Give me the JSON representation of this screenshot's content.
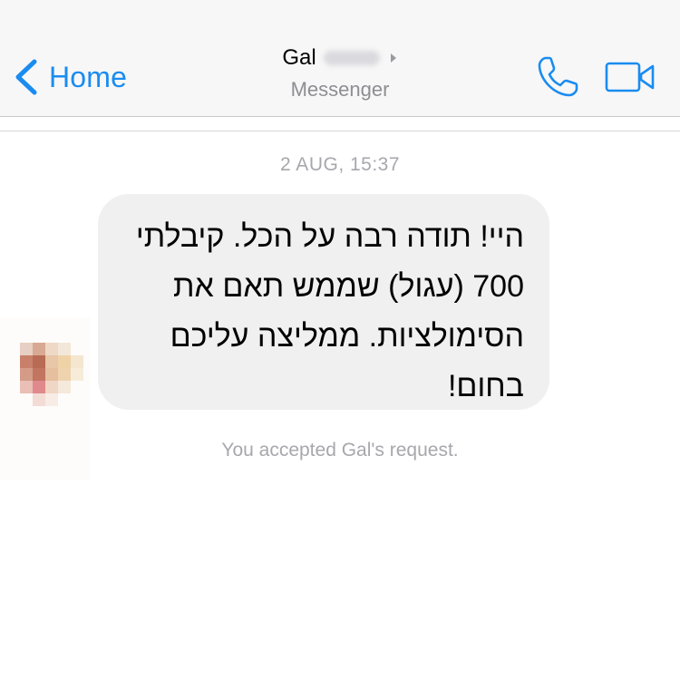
{
  "nav": {
    "back_label": "Home",
    "contact_name": "Gal",
    "subtitle": "Messenger",
    "accent_color": "#1a8cf0"
  },
  "icons": {
    "back": "chevron-left-icon",
    "title_arrow": "chevron-right-icon",
    "call": "phone-icon",
    "video": "video-camera-icon"
  },
  "conversation": {
    "timestamp": "2 AUG, 15:37",
    "messages": [
      {
        "direction": "incoming",
        "text": "היי! תודה רבה על הכל. קיבלתי 700 (עגול) שממש תאם את הסימולציות. ממליצה עליכם בחום!"
      }
    ],
    "system_note": "You accepted Gal's request."
  }
}
